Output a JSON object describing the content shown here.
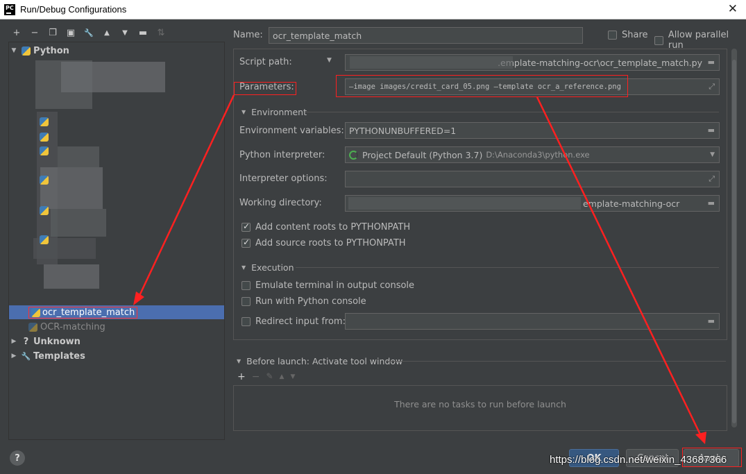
{
  "window": {
    "title": "Run/Debug Configurations",
    "icon_text": "PC",
    "close_glyph": "✕"
  },
  "toolbar": {
    "icons": [
      "add-icon",
      "remove-icon",
      "copy-icon",
      "save-icon",
      "wrench-icon",
      "move-up-icon",
      "move-down-icon",
      "folder-add-icon",
      "sort-icon"
    ],
    "glyphs": {
      "add": "+",
      "remove": "−",
      "copy": "❐",
      "save": "▣",
      "wrench": "🔧",
      "up": "▲",
      "down": "▼",
      "folder": "▬",
      "sort": "⇅"
    }
  },
  "tree": {
    "python_label": "Python",
    "selected_item": "ocr_template_match",
    "second_item": "OCR-matching",
    "unknown_label": "Unknown",
    "templates_label": "Templates",
    "expand_glyph": "▼",
    "collapse_glyph": "▶",
    "question_glyph": "?",
    "wrench_glyph": "🔧"
  },
  "header": {
    "name_label": "Name:",
    "name_value": "ocr_template_match",
    "share_label": "Share",
    "parallel_label": "Allow parallel run"
  },
  "config": {
    "script_path_label": "Script path:",
    "script_path_value": ".emplate-matching-ocr\\ocr_template_match.py",
    "parameters_label": "Parameters:",
    "parameters_value": "—image images/credit_card_05.png —template ocr_a_reference.png",
    "environment_header": "Environment",
    "env_vars_label": "Environment variables:",
    "env_vars_value": "PYTHONUNBUFFERED=1",
    "interpreter_label": "Python interpreter:",
    "interpreter_value": "Project Default (Python 3.7)",
    "interpreter_path": "D:\\Anaconda3\\python.exe",
    "interp_options_label": "Interpreter options:",
    "working_dir_label": "Working directory:",
    "working_dir_value": "emplate-matching-ocr",
    "add_content_roots": "Add content roots to PYTHONPATH",
    "add_source_roots": "Add source roots to PYTHONPATH",
    "execution_header": "Execution",
    "emulate_terminal": "Emulate terminal in output console",
    "run_with_console": "Run with Python console",
    "redirect_input": "Redirect input from:",
    "dropdown_glyph": "▼",
    "folder_glyph": "▬",
    "expand_glyph": "⤢"
  },
  "before_launch": {
    "header": "Before launch: Activate tool window",
    "empty_text": "There are no tasks to run before launch",
    "add_glyph": "+",
    "remove_glyph": "−",
    "edit_glyph": "✎",
    "up_glyph": "▲",
    "down_glyph": "▼"
  },
  "footer": {
    "ok_label": "OK",
    "cancel_label": "Cancel",
    "apply_label": "Apply",
    "help_glyph": "?",
    "watermark": "https://blog.csdn.net/weixin_43687366"
  },
  "colors": {
    "annotation_red": "#ff2020",
    "selection_blue": "#4b6eaf",
    "dialog_bg": "#3c3f41"
  }
}
